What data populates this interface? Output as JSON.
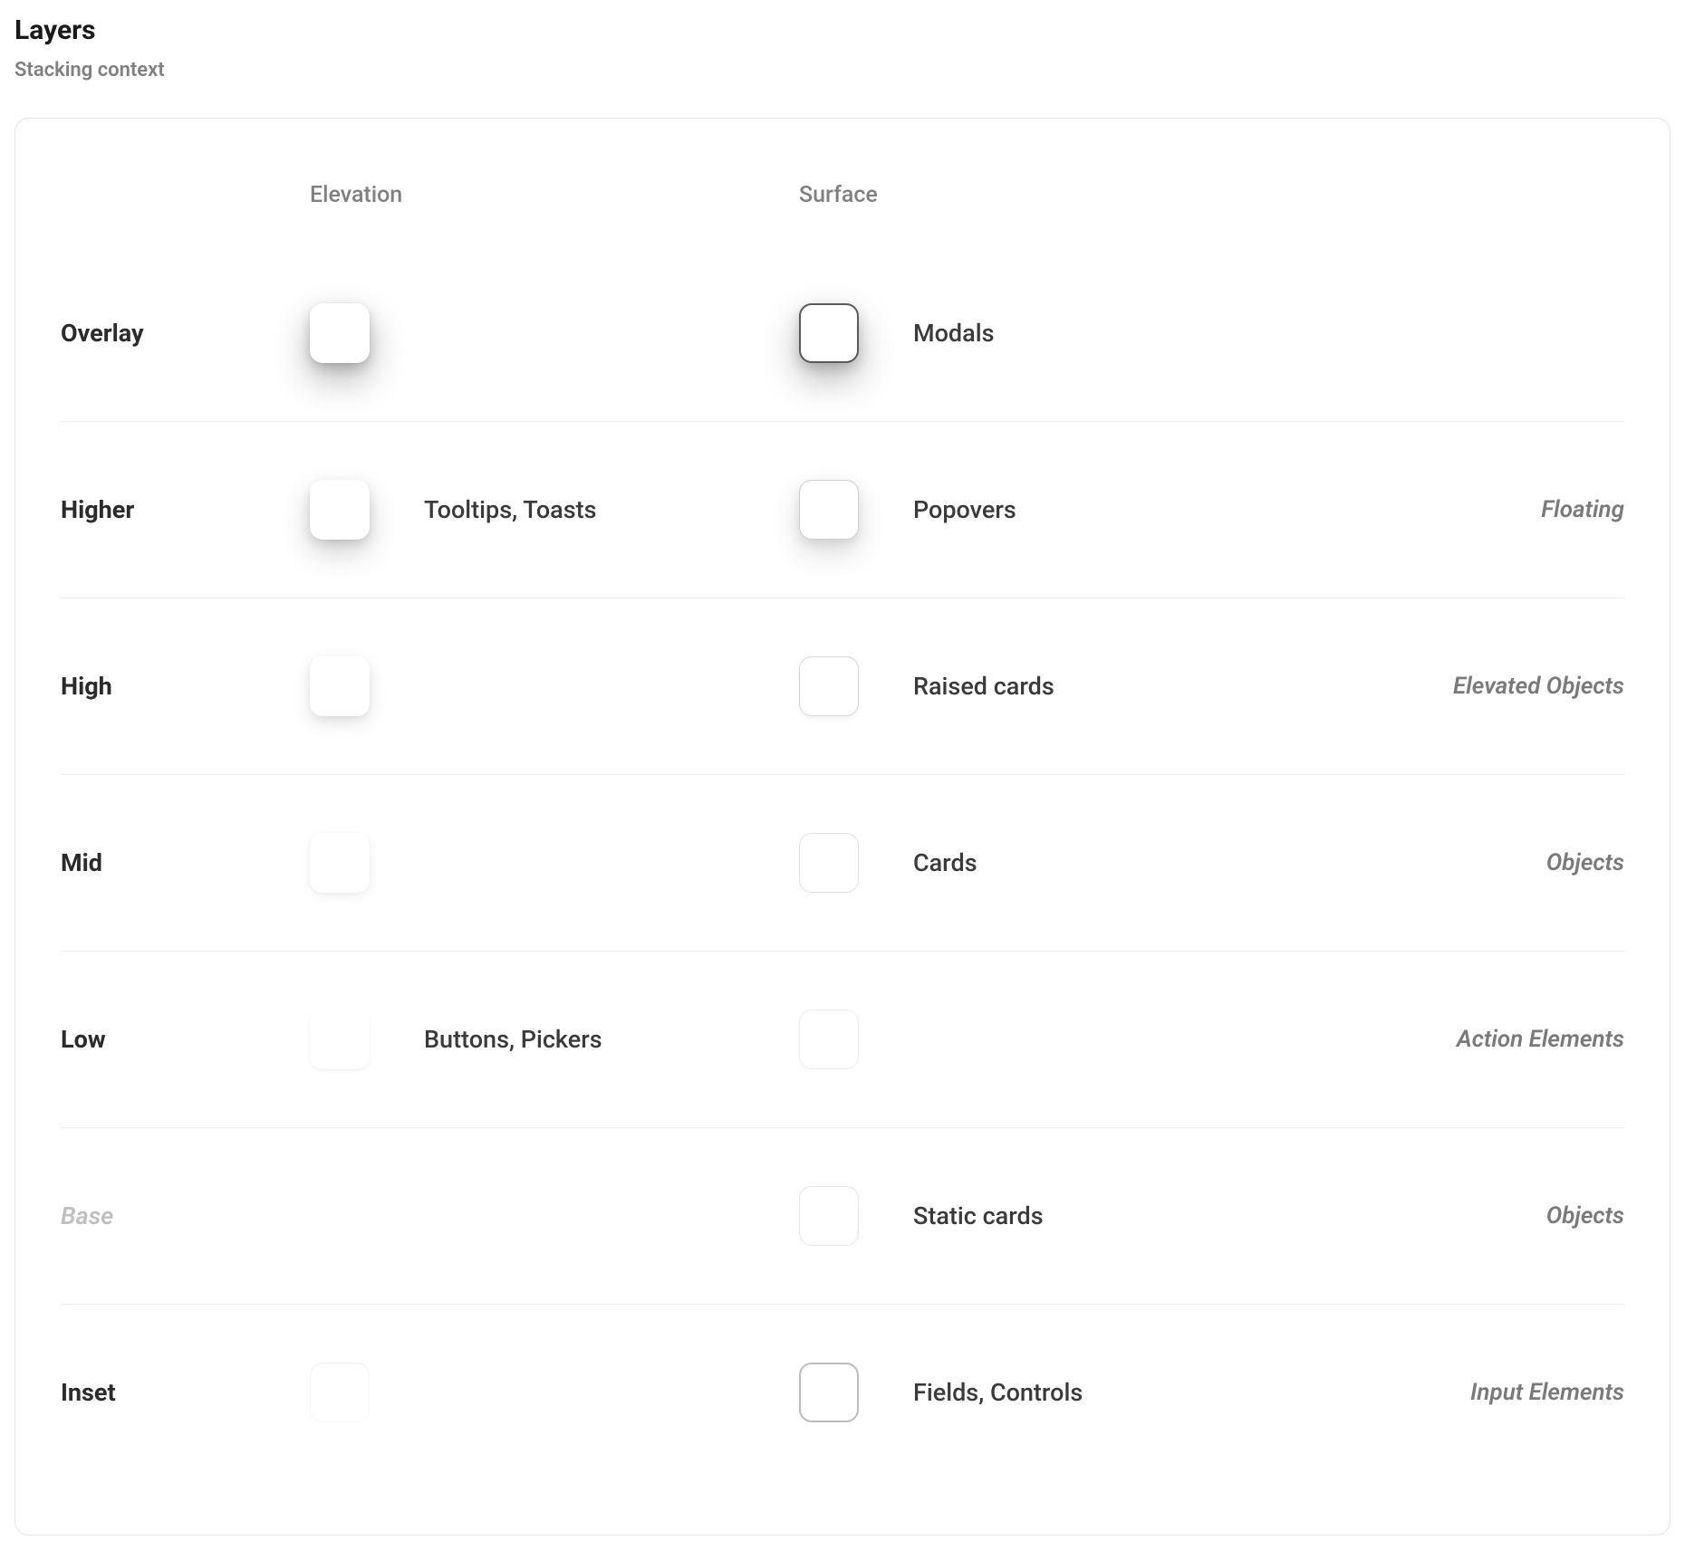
{
  "title": "Layers",
  "subtitle": "Stacking context",
  "columns": {
    "elevation": "Elevation",
    "surface": "Surface"
  },
  "rows": [
    {
      "level": "Overlay",
      "level_muted": false,
      "elevation_example": "",
      "elevation_class": "elev-overlay",
      "surface_example": "Modals",
      "surface_class": "surf-overlay",
      "category": ""
    },
    {
      "level": "Higher",
      "level_muted": false,
      "elevation_example": "Tooltips, Toasts",
      "elevation_class": "elev-higher",
      "surface_example": "Popovers",
      "surface_class": "surf-higher",
      "category": "Floating"
    },
    {
      "level": "High",
      "level_muted": false,
      "elevation_example": "",
      "elevation_class": "elev-high",
      "surface_example": "Raised cards",
      "surface_class": "surf-high",
      "category": "Elevated Objects"
    },
    {
      "level": "Mid",
      "level_muted": false,
      "elevation_example": "",
      "elevation_class": "elev-mid",
      "surface_example": "Cards",
      "surface_class": "surf-mid",
      "category": "Objects"
    },
    {
      "level": "Low",
      "level_muted": false,
      "elevation_example": "Buttons, Pickers",
      "elevation_class": "elev-low",
      "surface_example": "",
      "surface_class": "surf-low",
      "category": "Action Elements"
    },
    {
      "level": "Base",
      "level_muted": true,
      "elevation_example": "",
      "elevation_class": "",
      "surface_example": "Static cards",
      "surface_class": "surf-base",
      "category": "Objects"
    },
    {
      "level": "Inset",
      "level_muted": false,
      "elevation_example": "",
      "elevation_class": "elev-inset",
      "surface_example": "Fields, Controls",
      "surface_class": "surf-inset",
      "category": "Input Elements"
    }
  ]
}
